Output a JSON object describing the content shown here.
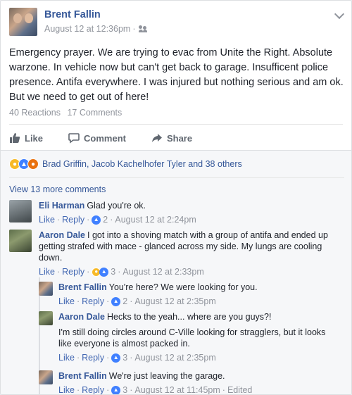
{
  "post": {
    "author": "Brent Fallin",
    "timestamp": "August 12 at 12:36pm",
    "audience_sep": "·",
    "text": "Emergency prayer. We are trying to evac from Unite the Right. Absolute warzone. In vehicle now but can't get back to garage. Insufficent police presence. Antifa everywhere. I was injured but nothing serious and am ok. But we need to get out of here!",
    "reactions_count": "40 Reactions",
    "comments_count": "17 Comments"
  },
  "actions": {
    "like": "Like",
    "comment": "Comment",
    "share": "Share"
  },
  "reactions_summary": "Brad Griffin, Jacob Kachelhofer Tyler and 38 others",
  "view_more": "View 13 more comments",
  "comments": [
    {
      "name": "Eli Harman",
      "text": "Glad you're ok.",
      "like": "Like",
      "reply": "Reply",
      "count": "2",
      "time": "August 12 at 2:24pm"
    },
    {
      "name": "Aaron Dale",
      "text": "I got into a shoving match with a group of antifa and ended up getting strafed with mace - glanced across my side. My lungs are cooling down.",
      "like": "Like",
      "reply": "Reply",
      "count": "3",
      "time": "August 12 at 2:33pm"
    }
  ],
  "replies": [
    {
      "name": "Brent Fallin",
      "text": "You're here? We were looking for you.",
      "like": "Like",
      "reply": "Reply",
      "count": "2",
      "time": "August 12 at 2:35pm"
    },
    {
      "name": "Aaron Dale",
      "text": "Hecks to the yeah... where are you guys?!",
      "text2": "I'm still doing circles around C-Ville looking for stragglers, but it looks like everyone is almost packed in.",
      "like": "Like",
      "reply": "Reply",
      "count": "3",
      "time": "August 12 at 2:35pm"
    },
    {
      "name": "Brent Fallin",
      "text": "We're just leaving the garage.",
      "like": "Like",
      "reply": "Reply",
      "count": "3",
      "time": "August 12 at 11:45pm",
      "edited": "Edited"
    }
  ],
  "colors": {
    "link": "#365899",
    "meta": "#90949c",
    "like_blue": "#4080ff",
    "wow_yellow": "#f7b928",
    "angry_orange": "#e9710f"
  }
}
